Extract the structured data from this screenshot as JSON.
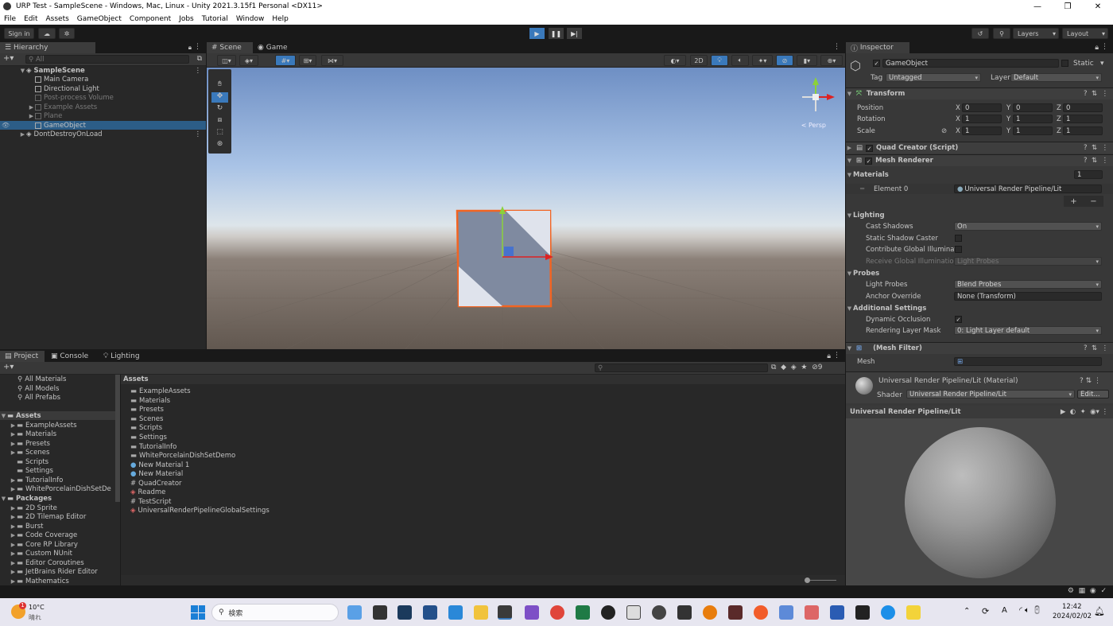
{
  "window": {
    "title": "URP Test - SampleScene - Windows, Mac, Linux - Unity 2021.3.15f1 Personal <DX11>",
    "controls": [
      "—",
      "❐",
      "✕"
    ]
  },
  "menu": [
    "File",
    "Edit",
    "Assets",
    "GameObject",
    "Component",
    "Jobs",
    "Tutorial",
    "Window",
    "Help"
  ],
  "toolbar": {
    "sign_in": "Sign in",
    "layers": "Layers",
    "layout": "Layout"
  },
  "hierarchy": {
    "tab": "Hierarchy",
    "search_placeholder": "All",
    "scene": "SampleScene",
    "items": [
      {
        "label": "Main Camera"
      },
      {
        "label": "Directional Light"
      },
      {
        "label": "Post-process Volume"
      },
      {
        "label": "Example Assets"
      },
      {
        "label": "Plane"
      },
      {
        "label": "GameObject"
      },
      {
        "label": "DontDestroyOnLoad"
      }
    ]
  },
  "scene_view": {
    "tabs": [
      "Scene",
      "Game"
    ],
    "btn_2d": "2D",
    "persp": "Persp"
  },
  "inspector": {
    "tab": "Inspector",
    "object_name": "GameObject",
    "static_label": "Static",
    "tag_label": "Tag",
    "tag_value": "Untagged",
    "layer_label": "Layer",
    "layer_value": "Default",
    "transform": {
      "title": "Transform",
      "position_label": "Position",
      "rotation_label": "Rotation",
      "scale_label": "Scale",
      "position": [
        "0",
        "0",
        "0"
      ],
      "rotation": [
        "1",
        "1",
        "1"
      ],
      "scale": [
        "1",
        "1",
        "1"
      ],
      "axes": [
        "X",
        "Y",
        "Z"
      ]
    },
    "quad_creator": "Quad Creator (Script)",
    "mesh_renderer": "Mesh Renderer",
    "materials_label": "Materials",
    "materials_count": "1",
    "element0_label": "Element 0",
    "element0_value": "Universal Render Pipeline/Lit",
    "plus": "+",
    "minus": "−",
    "lighting": "Lighting",
    "cast_shadows_label": "Cast Shadows",
    "cast_shadows_value": "On",
    "static_shadow_caster": "Static Shadow Caster",
    "contribute_gi": "Contribute Global Illuminati",
    "receive_gi_label": "Receive Global Illumination",
    "receive_gi_value": "Light Probes",
    "probes": "Probes",
    "light_probes_label": "Light Probes",
    "light_probes_value": "Blend Probes",
    "anchor_override_label": "Anchor Override",
    "anchor_override_value": "None (Transform)",
    "additional_settings": "Additional Settings",
    "dynamic_occlusion": "Dynamic Occlusion",
    "rendering_layer_mask_label": "Rendering Layer Mask",
    "rendering_layer_mask_value": "0: Light Layer default",
    "mesh_filter": "(Mesh Filter)",
    "mesh_label": "Mesh",
    "material_title": "Universal Render Pipeline/Lit (Material)",
    "shader_label": "Shader",
    "shader_value": "Universal Render Pipeline/Lit",
    "edit_button": "Edit...",
    "preview_title": "Universal Render Pipeline/Lit"
  },
  "project": {
    "tabs": [
      "Project",
      "Console",
      "Lighting"
    ],
    "favorites": [
      "All Materials",
      "All Models",
      "All Prefabs"
    ],
    "assets_root": "Assets",
    "asset_folders": [
      "ExampleAssets",
      "Materials",
      "Presets",
      "Scenes",
      "Scripts",
      "Settings",
      "TutorialInfo",
      "WhitePorcelainDishSetDe"
    ],
    "packages_root": "Packages",
    "packages": [
      "2D Sprite",
      "2D Tilemap Editor",
      "Burst",
      "Code Coverage",
      "Core RP Library",
      "Custom NUnit",
      "Editor Coroutines",
      "JetBrains Rider Editor",
      "Mathematics"
    ],
    "breadcrumb": "Assets",
    "hidden_count": "9",
    "files": [
      {
        "label": "ExampleAssets",
        "kind": "folder"
      },
      {
        "label": "Materials",
        "kind": "folder"
      },
      {
        "label": "Presets",
        "kind": "folder"
      },
      {
        "label": "Scenes",
        "kind": "folder"
      },
      {
        "label": "Scripts",
        "kind": "folder"
      },
      {
        "label": "Settings",
        "kind": "folder"
      },
      {
        "label": "TutorialInfo",
        "kind": "folder"
      },
      {
        "label": "WhitePorcelainDishSetDemo",
        "kind": "folder"
      },
      {
        "label": "New Material 1",
        "kind": "material"
      },
      {
        "label": "New Material",
        "kind": "material"
      },
      {
        "label": "QuadCreator",
        "kind": "script"
      },
      {
        "label": "Readme",
        "kind": "readme"
      },
      {
        "label": "TestScript",
        "kind": "script"
      },
      {
        "label": "UniversalRenderPipelineGlobalSettings",
        "kind": "settings"
      }
    ]
  },
  "taskbar": {
    "weather_temp": "10°C",
    "weather_desc": "晴れ",
    "search_placeholder": "検索",
    "time": "12:42",
    "date": "2024/02/02",
    "ime": "A",
    "notif_badge": "1"
  },
  "colors": {
    "selection": "#2c5d87",
    "panel_bg": "#282828",
    "outline": "#f26422",
    "accent_blue": "#3a79bb"
  }
}
